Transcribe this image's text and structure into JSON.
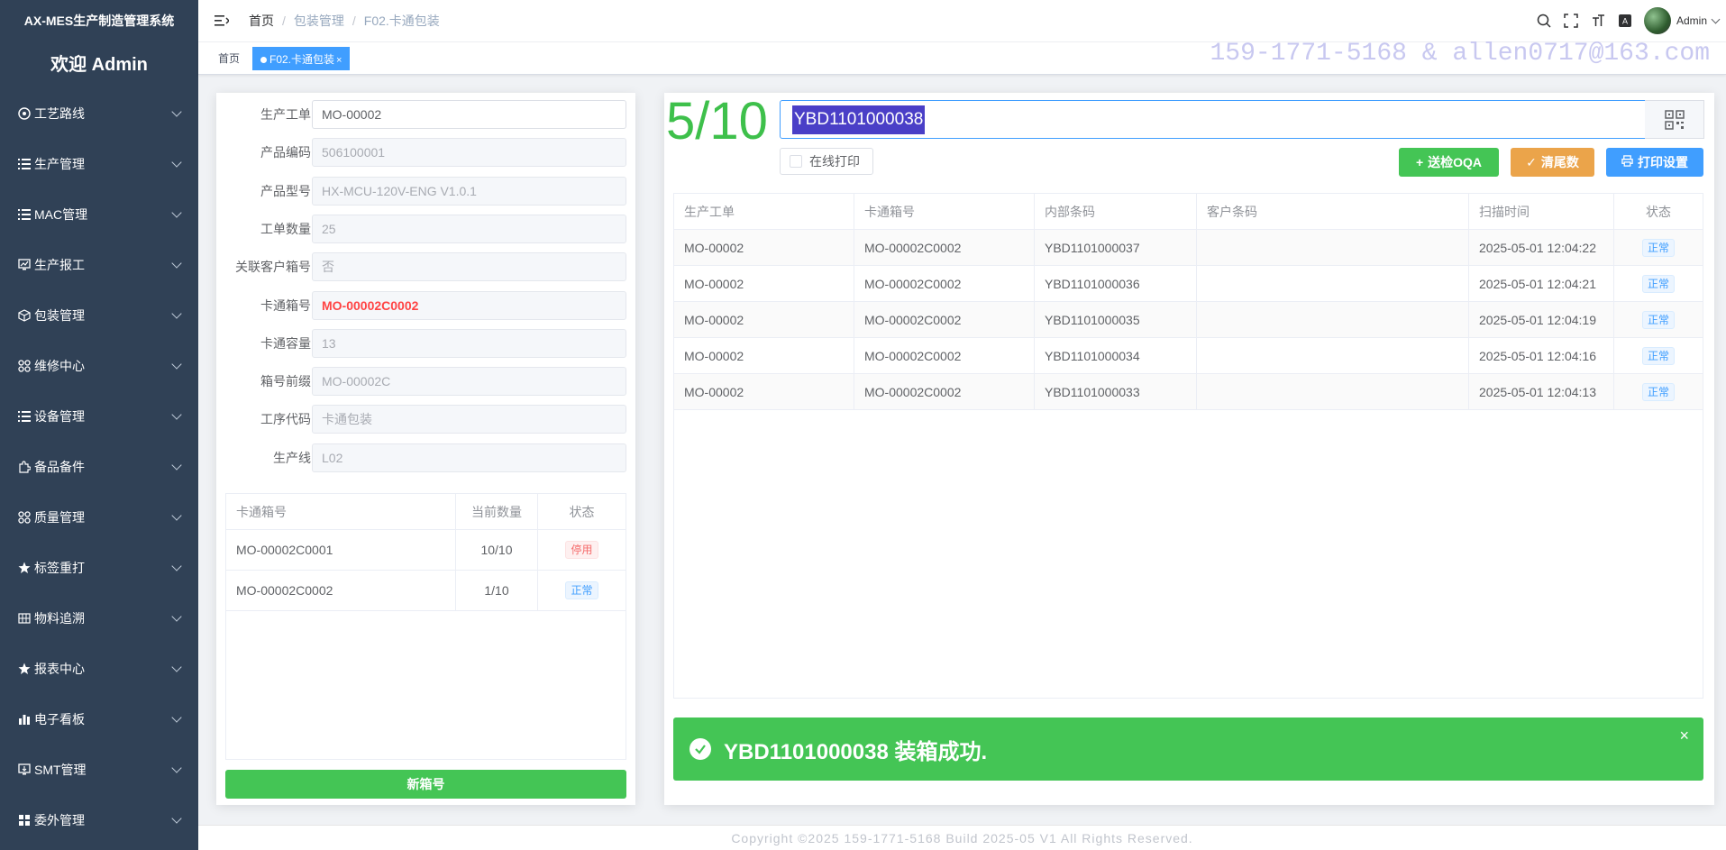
{
  "sidebar": {
    "brand": "AX-MES生产制造管理系统",
    "welcome": "欢迎 Admin",
    "items": [
      {
        "label": "工艺路线",
        "icon": "route-icon"
      },
      {
        "label": "生产管理",
        "icon": "list-icon"
      },
      {
        "label": "MAC管理",
        "icon": "list-icon"
      },
      {
        "label": "生产报工",
        "icon": "monitor-chart-icon"
      },
      {
        "label": "包装管理",
        "icon": "box-icon"
      },
      {
        "label": "维修中心",
        "icon": "apps-icon"
      },
      {
        "label": "设备管理",
        "icon": "list-icon"
      },
      {
        "label": "备品备件",
        "icon": "puzzle-icon"
      },
      {
        "label": "质量管理",
        "icon": "apps-icon"
      },
      {
        "label": "标签重打",
        "icon": "star-icon"
      },
      {
        "label": "物料追溯",
        "icon": "grid-icon"
      },
      {
        "label": "报表中心",
        "icon": "star-icon"
      },
      {
        "label": "电子看板",
        "icon": "bar-chart-icon"
      },
      {
        "label": "SMT管理",
        "icon": "monitor-icon"
      },
      {
        "label": "委外管理",
        "icon": "tiles-icon"
      }
    ]
  },
  "header": {
    "breadcrumb": [
      "首页",
      "包装管理",
      "F02.卡通包装"
    ],
    "user": "Admin"
  },
  "tags": {
    "home": "首页",
    "active": "F02.卡通包装"
  },
  "contact": "159-1771-5168 & allen0717@163.com",
  "form": {
    "fields": [
      {
        "label": "生产工单",
        "value": "MO-00002",
        "style": "normal"
      },
      {
        "label": "产品编码",
        "value": "506100001",
        "style": "dis"
      },
      {
        "label": "产品型号",
        "value": "HX-MCU-120V-ENG V1.0.1",
        "style": "dis"
      },
      {
        "label": "工单数量",
        "value": "25",
        "style": "dis"
      },
      {
        "label": "关联客户箱号",
        "value": "否",
        "style": "dis"
      },
      {
        "label": "卡通箱号",
        "value": "MO-00002C0002",
        "style": "red"
      },
      {
        "label": "卡通容量",
        "value": "13",
        "style": "dis"
      },
      {
        "label": "箱号前缀",
        "value": "MO-00002C",
        "style": "dis"
      },
      {
        "label": "工序代码",
        "value": "卡通包装",
        "style": "dis"
      },
      {
        "label": "生产线",
        "value": "L02",
        "style": "dis"
      }
    ]
  },
  "box_table": {
    "headers": [
      "卡通箱号",
      "当前数量",
      "状态"
    ],
    "rows": [
      {
        "box": "MO-00002C0001",
        "qty": "10/10",
        "status": "停用",
        "color": "red"
      },
      {
        "box": "MO-00002C0002",
        "qty": "1/10",
        "status": "正常",
        "color": "blue"
      }
    ],
    "new_button": "新箱号"
  },
  "scan": {
    "counter": "5/10",
    "input_value": "YBD1101000038",
    "online_print": "在线打印",
    "btn_oqa": "送检OQA",
    "btn_clear": "清尾数",
    "btn_print": "打印设置"
  },
  "scan_table": {
    "headers": [
      "生产工单",
      "卡通箱号",
      "内部条码",
      "客户条码",
      "扫描时间",
      "状态"
    ],
    "rows": [
      [
        "MO-00002",
        "MO-00002C0002",
        "YBD1101000037",
        "",
        "2025-05-01 12:04:22",
        "正常"
      ],
      [
        "MO-00002",
        "MO-00002C0002",
        "YBD1101000036",
        "",
        "2025-05-01 12:04:21",
        "正常"
      ],
      [
        "MO-00002",
        "MO-00002C0002",
        "YBD1101000035",
        "",
        "2025-05-01 12:04:19",
        "正常"
      ],
      [
        "MO-00002",
        "MO-00002C0002",
        "YBD1101000034",
        "",
        "2025-05-01 12:04:16",
        "正常"
      ],
      [
        "MO-00002",
        "MO-00002C0002",
        "YBD1101000033",
        "",
        "2025-05-01 12:04:13",
        "正常"
      ]
    ]
  },
  "toast": {
    "message": "YBD1101000038 装箱成功."
  },
  "footer": "Copyright ©2025 159-1771-5168 Build 2025-05 V1 All Rights Reserved.",
  "colors": {
    "sidebar_bg": "#304156",
    "primary": "#409eff",
    "success": "#44c555",
    "warning": "#eba44a",
    "counter": "#3ec04b"
  }
}
